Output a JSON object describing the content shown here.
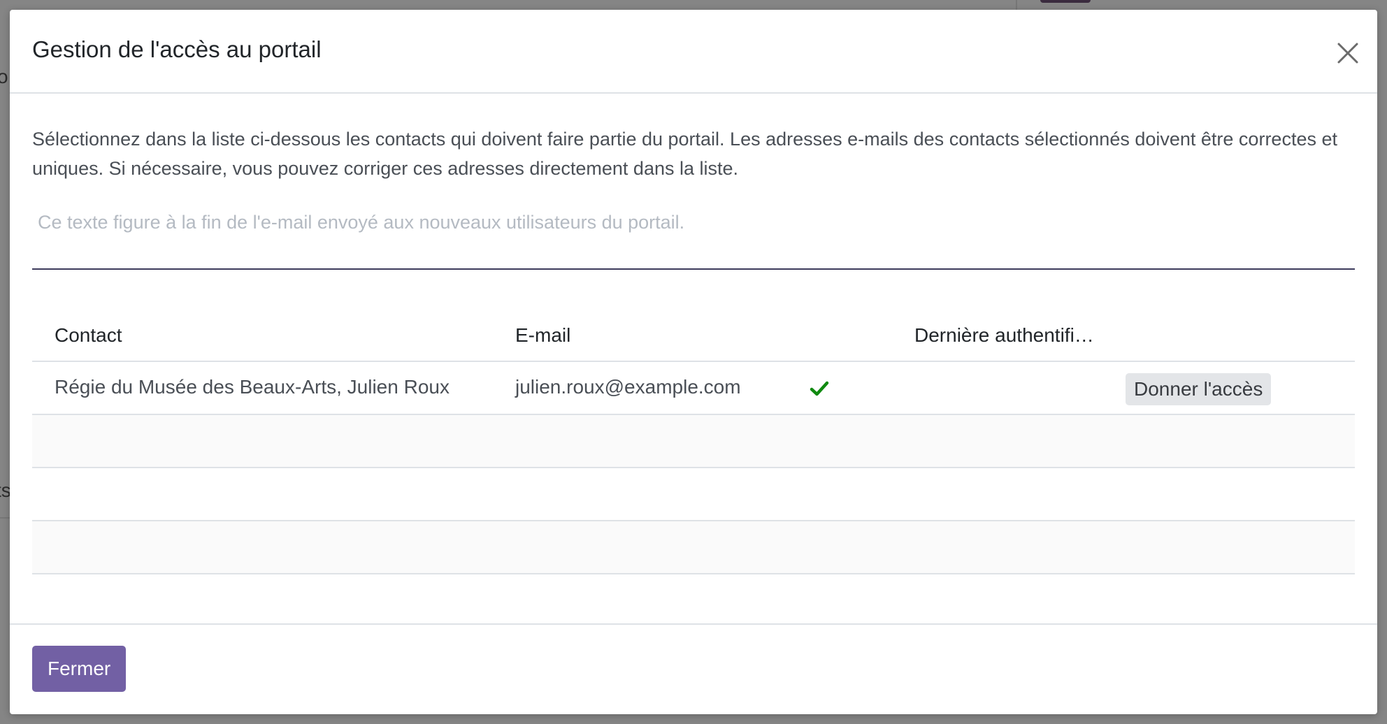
{
  "background": {
    "fragment_top": "o",
    "fragment_mid": "ts"
  },
  "dialog": {
    "title": "Gestion de l'accès au portail",
    "close_icon": "close-icon",
    "intro": "Sélectionnez dans la liste ci-dessous les contacts qui doivent faire partie du portail. Les adresses e-mails des contacts sélectionnés doivent être correctes et uniques. Si nécessaire, vous pouvez corriger ces adresses directement dans la liste.",
    "welcome_message": {
      "value": "",
      "placeholder": "Ce texte figure à la fin de l'e-mail envoyé aux nouveaux utilisateurs du portail."
    },
    "table": {
      "columns": [
        "Contact",
        "E-mail",
        "Dernière authentifi…"
      ],
      "rows": [
        {
          "contact": "Régie du Musée des Beaux-Arts, Julien Roux",
          "email": "julien.roux@example.com",
          "email_valid_icon": "check-icon",
          "last_login": "",
          "action_label": "Donner l'accès"
        }
      ]
    },
    "footer": {
      "close_label": "Fermer"
    }
  },
  "colors": {
    "primary": "#7260a4",
    "valid": "#108a10",
    "backdrop": "#858585"
  }
}
